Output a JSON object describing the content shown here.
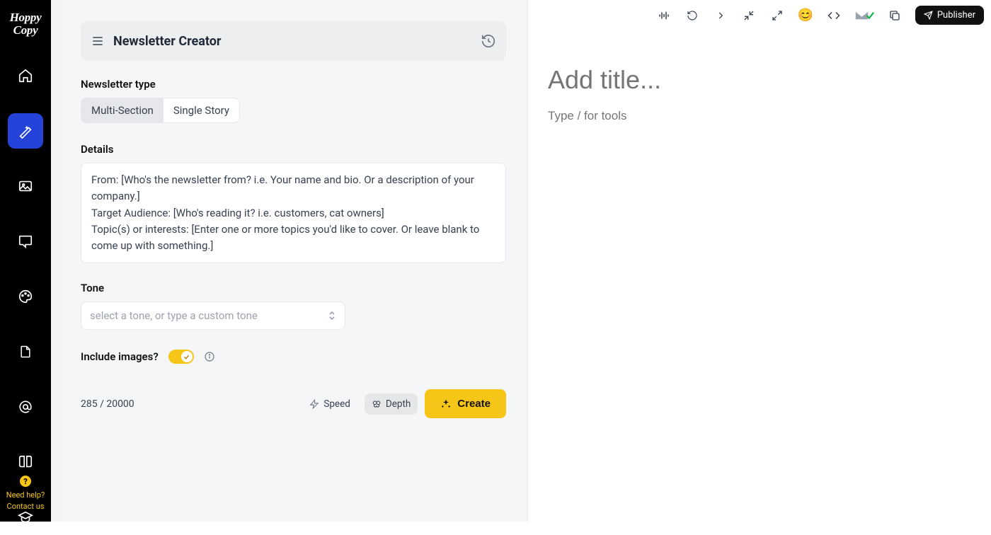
{
  "brand": {
    "line1": "Hoppy",
    "line2": "Copy"
  },
  "sidebar": {
    "help_line1": "Need help?",
    "help_line2": "Contact us"
  },
  "form": {
    "title": "Newsletter Creator",
    "type_label": "Newsletter type",
    "type_options": {
      "multi": "Multi-Section",
      "single": "Single Story"
    },
    "details_label": "Details",
    "details_value": "From: [Who's the newsletter from? i.e. Your name and bio. Or a description of your company.]\nTarget Audience: [Who's reading it? i.e. customers, cat owners]\nTopic(s) or interests: [Enter one or more topics you'd like to cover. Or leave blank to come up with something.]",
    "tone_label": "Tone",
    "tone_placeholder": "select a tone, or type a custom tone",
    "images_label": "Include images?",
    "char_count": "285 / 20000",
    "speed_label": "Speed",
    "depth_label": "Depth",
    "create_label": "Create"
  },
  "editor": {
    "title_placeholder": "Add title...",
    "body_placeholder": "Type / for tools",
    "publish_label": "Publisher"
  }
}
